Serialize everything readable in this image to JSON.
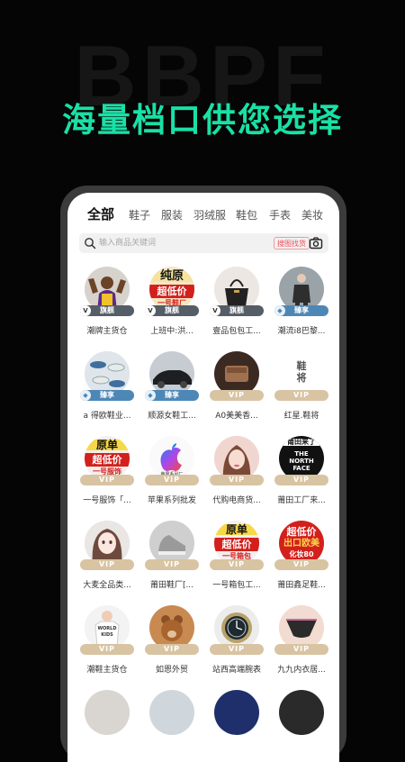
{
  "background": {
    "watermark": "BBPF",
    "headline": "海量档口供您选择"
  },
  "tabs": [
    "全部",
    "鞋子",
    "服装",
    "羽绒服",
    "鞋包",
    "手表",
    "美妆"
  ],
  "search": {
    "placeholder": "输入商品关键词",
    "image_search_label": "搜图找货"
  },
  "badges": {
    "vip": "VIP",
    "flagship": "旗舰",
    "share": "臻享"
  },
  "logo_text": {
    "chunyuan": [
      "纯原",
      "超低价",
      "一号鞋厂"
    ],
    "yuandan_fushi": [
      "原单",
      "超低价",
      "一号服饰"
    ],
    "yuandan_xiangbao": [
      "原单",
      "超低价",
      "一号箱包"
    ],
    "chaodijia_chukou": [
      "超低价",
      "出口欧美",
      "化妆80"
    ],
    "xiejiang": "鞋将",
    "putian": "莆田来了",
    "northface": [
      "THE",
      "NORTH",
      "FACE"
    ],
    "apple_caption": "苹果系列厂",
    "worldkids": [
      "WORLD",
      "KIDS"
    ]
  },
  "stores": [
    {
      "name": "潮牌主货仓",
      "badge": "flagship",
      "avatar": "basketball-player"
    },
    {
      "name": "上班中:洪...",
      "badge": "flagship",
      "avatar": "chunyuan-sign"
    },
    {
      "name": "壹品包包工...",
      "badge": "flagship",
      "avatar": "handbag"
    },
    {
      "name": "潮流i8巴黎...",
      "badge": "share",
      "avatar": "fashion-model"
    },
    {
      "name": "a 得欧鞋业...",
      "badge": "share",
      "avatar": "sneakers"
    },
    {
      "name": "顺源女鞋工...",
      "badge": "share",
      "avatar": "black-car"
    },
    {
      "name": "A0美美香...",
      "badge": "vip",
      "avatar": "leather-wallet"
    },
    {
      "name": "红星.鞋将",
      "badge": "vip",
      "avatar": "xiejiang-logo"
    },
    {
      "name": "一号服饰「...",
      "badge": "vip",
      "avatar": "yuandan-sign"
    },
    {
      "name": "苹果系列批发",
      "badge": "vip",
      "avatar": "apple-logo"
    },
    {
      "name": "代购电商货...",
      "badge": "vip",
      "avatar": "woman-portrait"
    },
    {
      "name": "莆田工厂来...",
      "badge": "vip",
      "avatar": "putian-sign"
    },
    {
      "name": "大麦全品类...",
      "badge": "vip",
      "avatar": "illustrated-girl"
    },
    {
      "name": "莆田鞋厂[...",
      "badge": "vip",
      "avatar": "grey-sneaker"
    },
    {
      "name": "一号箱包工...",
      "badge": "vip",
      "avatar": "yuandan-bag-sign"
    },
    {
      "name": "莆田鑫足鞋...",
      "badge": "vip",
      "avatar": "export-sign"
    },
    {
      "name": "潮鞋主货仓",
      "badge": "vip",
      "avatar": "baby-shirt"
    },
    {
      "name": "如恩外贸",
      "badge": "vip",
      "avatar": "bear-plush"
    },
    {
      "name": "站西高端腕表",
      "badge": "vip",
      "avatar": "wristwatch"
    },
    {
      "name": "九九内衣居...",
      "badge": "vip",
      "avatar": "underwear"
    }
  ],
  "colors": {
    "accent_green": "#19e0a6",
    "vip_badge": "#d8c4a2",
    "flagship_badge": "#555d66",
    "share_badge": "#4d87b6",
    "image_search_red": "#e8505c"
  }
}
